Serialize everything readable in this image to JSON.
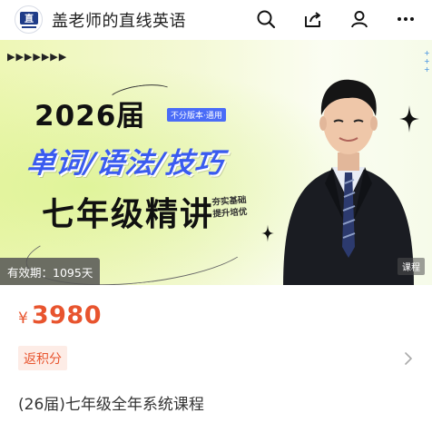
{
  "header": {
    "logo_text": "语",
    "shop_name": "盖老师的直线英语",
    "icons": [
      "search-icon",
      "share-icon",
      "user-icon",
      "more-icon"
    ]
  },
  "banner": {
    "year_text": "2026届",
    "edition_tag": "不分版本·通用",
    "subjects_text": "单词/语法/技巧",
    "grade_text": "七年级精讲",
    "motto_line1": "夯实基础",
    "motto_line2": "提升培优",
    "validity_label": "有效期：",
    "validity_value": "1095天",
    "course_tag": "课程"
  },
  "price": {
    "symbol": "¥",
    "value": "3980"
  },
  "points_badge": "返积分",
  "course_title": "(26届)七年级全年系统课程",
  "colors": {
    "accent": "#e8542e",
    "badge_bg": "#fdece6",
    "subjects_blue": "#3a5bf0",
    "tag_blue": "#4a6cf7"
  }
}
